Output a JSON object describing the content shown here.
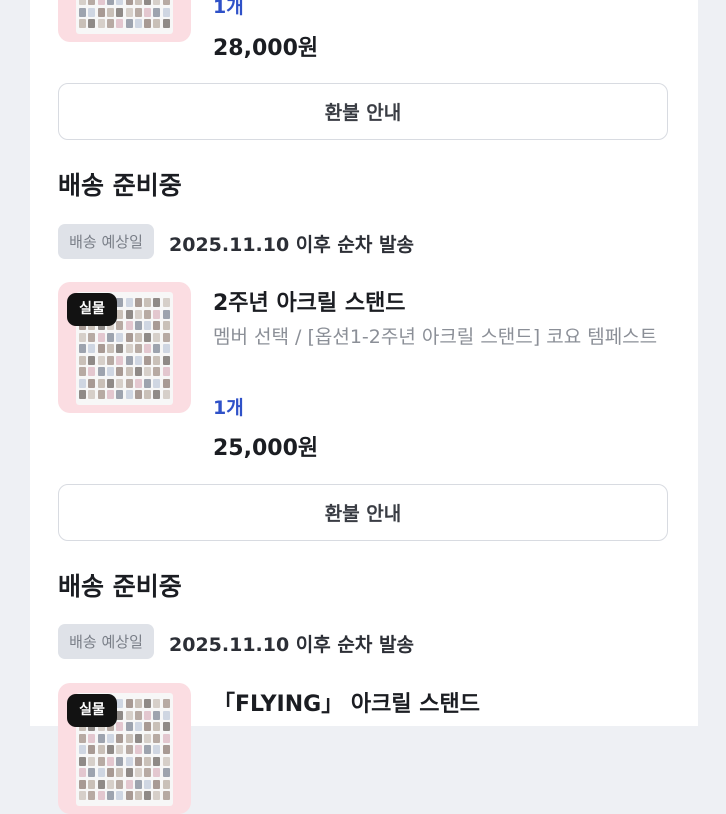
{
  "orders": [
    {
      "qty": "1개",
      "price": "28,000원",
      "refund_label": "환불 안내"
    },
    {
      "status": "배송 준비중",
      "ship_tag": "배송 예상일",
      "ship_date": "2025.11.10 이후 순차 발송",
      "badge": "실물",
      "title": "2주년 아크릴 스탠드",
      "option": "멤버 선택 / [옵션1-2주년 아크릴 스탠드] 코요 템페스트",
      "qty": "1개",
      "price": "25,000원",
      "refund_label": "환불 안내"
    },
    {
      "status": "배송 준비중",
      "ship_tag": "배송 예상일",
      "ship_date": "2025.11.10 이후 순차 발송",
      "badge": "실물",
      "title": "「FLYING」 아크릴 스탠드"
    }
  ],
  "colors": {
    "accent_qty": "#2f51c8",
    "badge_bg": "#121212",
    "thumb_bg": "#fbdde2"
  }
}
